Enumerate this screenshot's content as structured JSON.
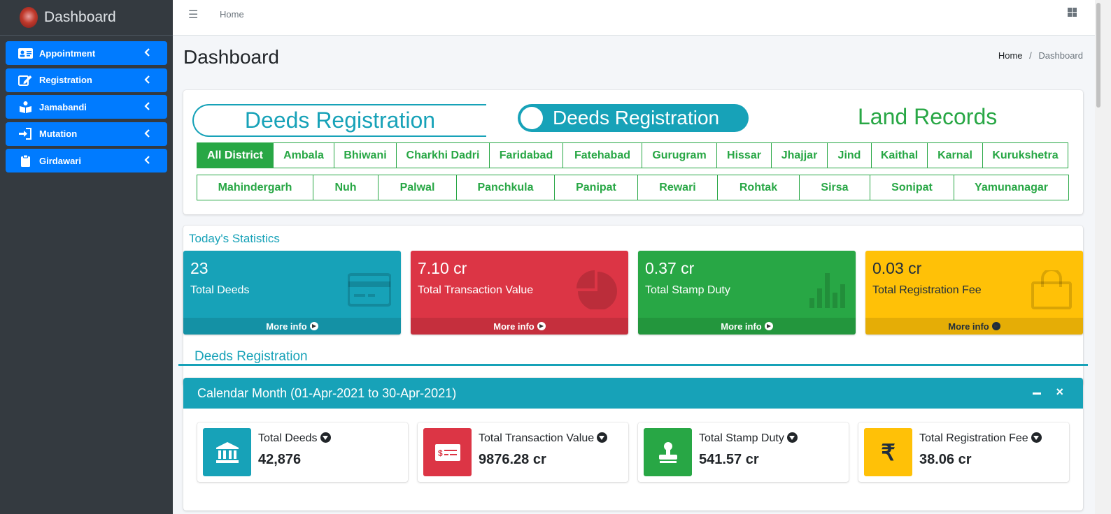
{
  "sidebar": {
    "brand": "Dashboard",
    "items": [
      {
        "label": "Appointment",
        "icon": "id-card-icon"
      },
      {
        "label": "Registration",
        "icon": "edit-icon"
      },
      {
        "label": "Jamabandi",
        "icon": "book-reader-icon"
      },
      {
        "label": "Mutation",
        "icon": "sign-in-icon"
      },
      {
        "label": "Girdawari",
        "icon": "clipboard-icon"
      }
    ]
  },
  "topbar": {
    "home": "Home"
  },
  "header": {
    "title": "Dashboard",
    "breadcrumb_home": "Home",
    "breadcrumb_sep": "/",
    "breadcrumb_current": "Dashboard"
  },
  "tabs": {
    "deeds_outline": "Deeds Registration",
    "deeds_toggle": "Deeds Registration",
    "land_records": "Land Records"
  },
  "districts_row1": [
    "All District",
    "Ambala",
    "Bhiwani",
    "Charkhi Dadri",
    "Faridabad",
    "Fatehabad",
    "Gurugram",
    "Hissar",
    "Jhajjar",
    "Jind",
    "Kaithal",
    "Karnal",
    "Kurukshetra"
  ],
  "districts_row2": [
    "Mahindergarh",
    "Nuh",
    "Palwal",
    "Panchkula",
    "Panipat",
    "Rewari",
    "Rohtak",
    "Sirsa",
    "Sonipat",
    "Yamunanagar"
  ],
  "today": {
    "heading": "Today's Statistics",
    "more_info": "More info",
    "boxes": [
      {
        "value": "23",
        "label": "Total Deeds",
        "color": "#17a2b8",
        "icon": "credit-card-icon"
      },
      {
        "value": "7.10 cr",
        "label": "Total Transaction Value",
        "color": "#dc3545",
        "icon": "pie-chart-icon"
      },
      {
        "value": "0.37 cr",
        "label": "Total Stamp Duty",
        "color": "#28a745",
        "icon": "bar-chart-icon"
      },
      {
        "value": "0.03 cr",
        "label": "Total Registration Fee",
        "color": "#ffc107",
        "icon": "shopping-bag-icon"
      }
    ]
  },
  "deeds_subheading": "Deeds Registration",
  "month": {
    "title": "Calendar Month (01-Apr-2021 to 30-Apr-2021)",
    "close_glyph": "×",
    "boxes": [
      {
        "label": "Total Deeds",
        "value": "42,876",
        "color": "#17a2b8",
        "icon": "bank-icon"
      },
      {
        "label": "Total Transaction Value",
        "value": "9876.28 cr",
        "color": "#dc3545",
        "icon": "money-check-icon"
      },
      {
        "label": "Total Stamp Duty",
        "value": "541.57 cr",
        "color": "#28a745",
        "icon": "stamp-icon"
      },
      {
        "label": "Total Registration Fee",
        "value": "38.06 cr",
        "color": "#ffc107",
        "icon": "rupee-icon",
        "glyph": "₹"
      }
    ]
  }
}
